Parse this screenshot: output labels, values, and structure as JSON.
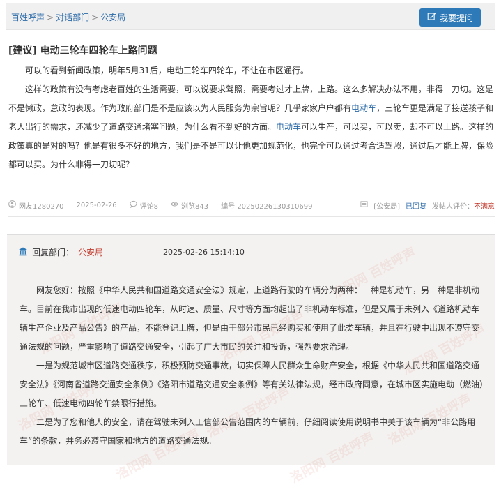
{
  "breadcrumb": {
    "items": [
      "百姓呼声",
      "对话部门",
      "公安局"
    ],
    "separator": ">"
  },
  "ask_button": {
    "label": "我要提问",
    "icon": "edit-icon"
  },
  "post": {
    "tag": "[建议]",
    "title": "电动三轮车四轮车上路问题",
    "paragraphs": [
      [
        {
          "t": "可以的看到新闻政策，明年5月31后，电动三轮车四轮车，不让在市区通行。"
        }
      ],
      [
        {
          "t": "这样的政策有没有考虑老百姓的生活需要，可以说要求驾照，需要考过才上牌，上路。这么多解决办法不用，非得一刀切。这是不是懒政，怠政的表现。作为政府部门是不是应该以为人民服务为宗旨呢？几乎家家户户都有"
        },
        {
          "t": "电动车",
          "kw": true
        },
        {
          "t": "，三轮车更是满足了接送孩子和老人出行的需求，还减少了道路交通堵塞问题，为什么看不到好的方面。"
        },
        {
          "t": "电动车",
          "kw": true
        },
        {
          "t": "可以生产，可以买，可以卖，却不可以上路。这样的政策真的是对的吗？他是有很多不好的地方，我们是不是可以让他更加规范化，也完全可以通过考合适驾照，通过后才能上牌，保险都可以买。为什么非得一刀切呢？"
        }
      ]
    ],
    "meta": {
      "user": "网友1280270",
      "date": "2025-02-26",
      "comments": "评论8",
      "views": "浏览843",
      "number": "编号 20250226130310699",
      "dept": "[公安局]",
      "status": "已回复",
      "rating_label": "发帖人评价：",
      "rating": "不满意"
    }
  },
  "reply": {
    "label": "回复部门：",
    "dept": "公安局",
    "time": "2025-02-26 15:14:10",
    "paragraphs": [
      "网友您好：按照《中华人民共和国道路交通安全法》规定，上道路行驶的车辆分为两种：一种是机动车，另一种是非机动车。目前在我市出现的低速电动四轮车，从时速、质量、尺寸等方面均超出了非机动车标准，但是又属于未列入《道路机动车辆生产企业及产品公告》的产品，不能登记上牌，但是由于部分市民已经购买和使用了此类车辆，并且在行驶中出现不遵守交通法规的问题，严重影响了道路交通安全，引起了广大市民的关注和投诉，强烈要求治理。",
      "一是为规范城市区道路交通秩序，积极预防交通事故，切实保障人民群众生命财产安全，根据《中华人民共和国道路交通安全法》《河南省道路交通安全条例》《洛阳市道路交通安全条例》等有关法律法规，经市政府同意，在城市区实施电动（燃油）三轮车、低速电动四轮车禁限行措施。",
      "二是为了您和他人的安全，请在驾驶未列入工信部公告范围内的车辆前，仔细阅读使用说明书中关于该车辆为“非公路用车”的条款，并务必遵守国家和地方的道路交通法规。"
    ]
  },
  "watermark": {
    "text": "洛阳网 百姓呼声",
    "color": "#cd786e"
  },
  "colors": {
    "link": "#2b6aa8",
    "accent": "#2e7ab8",
    "alert": "#c0392b"
  }
}
